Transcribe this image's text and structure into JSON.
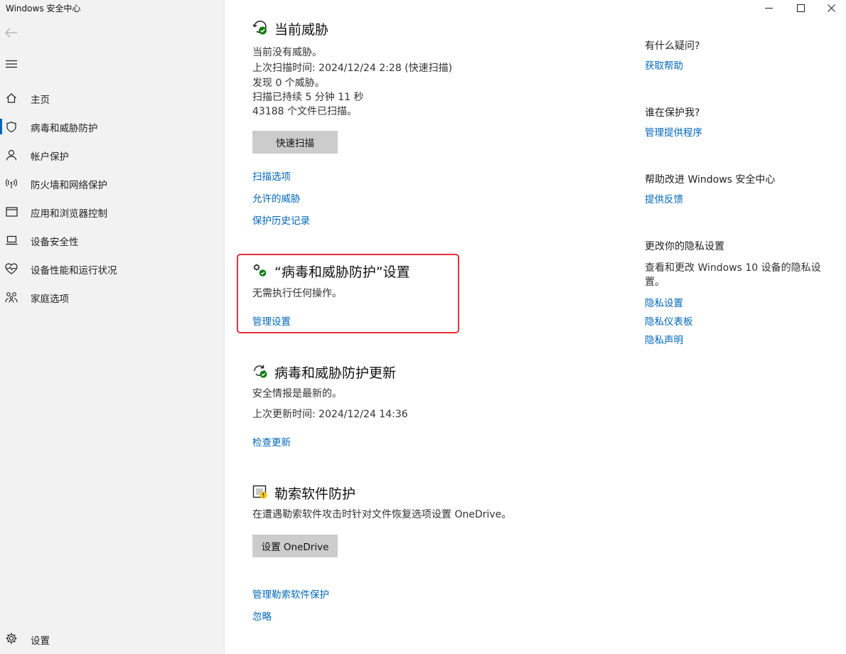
{
  "window": {
    "title": "Windows 安全中心"
  },
  "sidebar": {
    "items": [
      {
        "label": "主页",
        "icon": "home-icon"
      },
      {
        "label": "病毒和威胁防护",
        "icon": "shield-icon",
        "active": true
      },
      {
        "label": "帐户保护",
        "icon": "person-icon"
      },
      {
        "label": "防火墙和网络保护",
        "icon": "wifi-icon"
      },
      {
        "label": "应用和浏览器控制",
        "icon": "app-window-icon"
      },
      {
        "label": "设备安全性",
        "icon": "laptop-icon"
      },
      {
        "label": "设备性能和运行状况",
        "icon": "heart-pulse-icon"
      },
      {
        "label": "家庭选项",
        "icon": "family-icon"
      }
    ],
    "settings_label": "设置"
  },
  "current_threats": {
    "title": "当前威胁",
    "lines": [
      "当前没有威胁。",
      "上次扫描时间: 2024/12/24 2:28 (快速扫描)",
      "发现 0 个威胁。",
      "扫描已持续 5 分钟 11 秒",
      "43188 个文件已扫描。"
    ],
    "scan_button": "快速扫描",
    "links": [
      "扫描选项",
      "允许的威胁",
      "保护历史记录"
    ]
  },
  "protection_settings": {
    "title": "“病毒和威胁防护”设置",
    "status": "无需执行任何操作。",
    "link": "管理设置"
  },
  "updates": {
    "title": "病毒和威胁防护更新",
    "lines": [
      "安全情报是最新的。",
      "上次更新时间: 2024/12/24 14:36"
    ],
    "link": "检查更新"
  },
  "ransomware": {
    "title": "勒索软件防护",
    "desc": "在遭遇勒索软件攻击时针对文件恢复选项设置 OneDrive。",
    "button": "设置 OneDrive",
    "links": [
      "管理勒索软件保护",
      "忽略"
    ]
  },
  "aside": {
    "question_head": "有什么疑问?",
    "question_link": "获取帮助",
    "protect_head": "谁在保护我?",
    "protect_link": "管理提供程序",
    "improve_head": "帮助改进 Windows 安全中心",
    "improve_link": "提供反馈",
    "privacy_head": "更改你的隐私设置",
    "privacy_text": "查看和更改 Windows 10 设备的隐私设置。",
    "privacy_links": [
      "隐私设置",
      "隐私仪表板",
      "隐私声明"
    ]
  },
  "colors": {
    "link": "#0067b8",
    "sidebar_bg": "#f2f2f2",
    "highlight": "#e8303d",
    "ok_green": "#107c10"
  }
}
